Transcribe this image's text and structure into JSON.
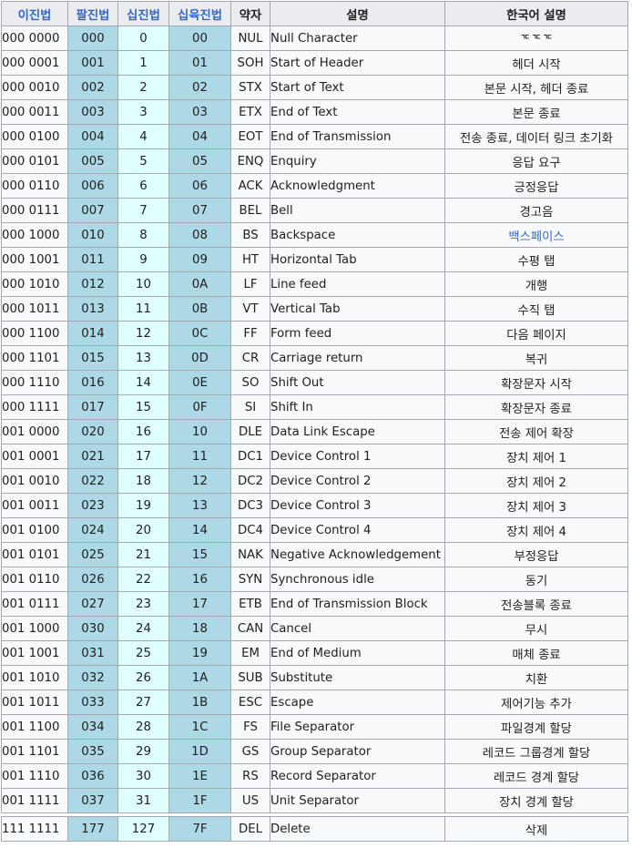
{
  "headers": {
    "binary": "이진법",
    "octal": "팔진법",
    "decimal": "십진법",
    "hex": "십육진법",
    "abbr": "약자",
    "name": "설명",
    "korean": "한국어 설명"
  },
  "rows": [
    {
      "bin": "000 0000",
      "oct": "000",
      "dec": "0",
      "hex": "00",
      "abbr": "NUL",
      "name": "Null Character",
      "kor": "ᄀᄃᄀᄃᄀᄃ"
    },
    {
      "bin": "000 0001",
      "oct": "001",
      "dec": "1",
      "hex": "01",
      "abbr": "SOH",
      "name": "Start of Header",
      "kor": "헤더 시작"
    },
    {
      "bin": "000 0010",
      "oct": "002",
      "dec": "2",
      "hex": "02",
      "abbr": "STX",
      "name": "Start of Text",
      "kor": "본문 시작, 헤더 종료"
    },
    {
      "bin": "000 0011",
      "oct": "003",
      "dec": "3",
      "hex": "03",
      "abbr": "ETX",
      "name": "End of Text",
      "kor": "본문 종료"
    },
    {
      "bin": "000 0100",
      "oct": "004",
      "dec": "4",
      "hex": "04",
      "abbr": "EOT",
      "name": "End of Transmission",
      "kor": "전송 종료, 데이터 링크 초기화"
    },
    {
      "bin": "000 0101",
      "oct": "005",
      "dec": "5",
      "hex": "05",
      "abbr": "ENQ",
      "name": "Enquiry",
      "kor": "응답 요구"
    },
    {
      "bin": "000 0110",
      "oct": "006",
      "dec": "6",
      "hex": "06",
      "abbr": "ACK",
      "name": "Acknowledgment",
      "kor": "긍정응답"
    },
    {
      "bin": "000 0111",
      "oct": "007",
      "dec": "7",
      "hex": "07",
      "abbr": "BEL",
      "name": "Bell",
      "kor": "경고음"
    },
    {
      "bin": "000 1000",
      "oct": "010",
      "dec": "8",
      "hex": "08",
      "abbr": "BS",
      "name": "Backspace",
      "kor": "백스페이스",
      "link": true
    },
    {
      "bin": "000 1001",
      "oct": "011",
      "dec": "9",
      "hex": "09",
      "abbr": "HT",
      "name": "Horizontal Tab",
      "kor": "수평 탭"
    },
    {
      "bin": "000 1010",
      "oct": "012",
      "dec": "10",
      "hex": "0A",
      "abbr": "LF",
      "name": "Line feed",
      "kor": "개행"
    },
    {
      "bin": "000 1011",
      "oct": "013",
      "dec": "11",
      "hex": "0B",
      "abbr": "VT",
      "name": "Vertical Tab",
      "kor": "수직 탭"
    },
    {
      "bin": "000 1100",
      "oct": "014",
      "dec": "12",
      "hex": "0C",
      "abbr": "FF",
      "name": "Form feed",
      "kor": "다음 페이지"
    },
    {
      "bin": "000 1101",
      "oct": "015",
      "dec": "13",
      "hex": "0D",
      "abbr": "CR",
      "name": "Carriage return",
      "kor": "복귀"
    },
    {
      "bin": "000 1110",
      "oct": "016",
      "dec": "14",
      "hex": "0E",
      "abbr": "SO",
      "name": "Shift Out",
      "kor": "확장문자 시작"
    },
    {
      "bin": "000 1111",
      "oct": "017",
      "dec": "15",
      "hex": "0F",
      "abbr": "SI",
      "name": "Shift In",
      "kor": "확장문자 종료"
    },
    {
      "bin": "001 0000",
      "oct": "020",
      "dec": "16",
      "hex": "10",
      "abbr": "DLE",
      "name": "Data Link Escape",
      "kor": "전송 제어 확장"
    },
    {
      "bin": "001 0001",
      "oct": "021",
      "dec": "17",
      "hex": "11",
      "abbr": "DC1",
      "name": "Device Control 1",
      "kor": "장치 제어 1"
    },
    {
      "bin": "001 0010",
      "oct": "022",
      "dec": "18",
      "hex": "12",
      "abbr": "DC2",
      "name": "Device Control 2",
      "kor": "장치 제어 2"
    },
    {
      "bin": "001 0011",
      "oct": "023",
      "dec": "19",
      "hex": "13",
      "abbr": "DC3",
      "name": "Device Control 3",
      "kor": "장치 제어 3"
    },
    {
      "bin": "001 0100",
      "oct": "024",
      "dec": "20",
      "hex": "14",
      "abbr": "DC4",
      "name": "Device Control 4",
      "kor": "장치 제어 4"
    },
    {
      "bin": "001 0101",
      "oct": "025",
      "dec": "21",
      "hex": "15",
      "abbr": "NAK",
      "name": "Negative Acknowledgement",
      "kor": "부정응답"
    },
    {
      "bin": "001 0110",
      "oct": "026",
      "dec": "22",
      "hex": "16",
      "abbr": "SYN",
      "name": "Synchronous idle",
      "kor": "동기"
    },
    {
      "bin": "001 0111",
      "oct": "027",
      "dec": "23",
      "hex": "17",
      "abbr": "ETB",
      "name": "End of Transmission Block",
      "kor": "전송블록 종료"
    },
    {
      "bin": "001 1000",
      "oct": "030",
      "dec": "24",
      "hex": "18",
      "abbr": "CAN",
      "name": "Cancel",
      "kor": "무시"
    },
    {
      "bin": "001 1001",
      "oct": "031",
      "dec": "25",
      "hex": "19",
      "abbr": "EM",
      "name": "End of Medium",
      "kor": "매체 종료"
    },
    {
      "bin": "001 1010",
      "oct": "032",
      "dec": "26",
      "hex": "1A",
      "abbr": "SUB",
      "name": "Substitute",
      "kor": "치환"
    },
    {
      "bin": "001 1011",
      "oct": "033",
      "dec": "27",
      "hex": "1B",
      "abbr": "ESC",
      "name": "Escape",
      "kor": "제어기능 추가"
    },
    {
      "bin": "001 1100",
      "oct": "034",
      "dec": "28",
      "hex": "1C",
      "abbr": "FS",
      "name": "File Separator",
      "kor": "파일경계 할당"
    },
    {
      "bin": "001 1101",
      "oct": "035",
      "dec": "29",
      "hex": "1D",
      "abbr": "GS",
      "name": "Group Separator",
      "kor": "레코드 그룹경계 할당"
    },
    {
      "bin": "001 1110",
      "oct": "036",
      "dec": "30",
      "hex": "1E",
      "abbr": "RS",
      "name": "Record Separator",
      "kor": "레코드 경계 할당"
    },
    {
      "bin": "001 1111",
      "oct": "037",
      "dec": "31",
      "hex": "1F",
      "abbr": "US",
      "name": "Unit Separator",
      "kor": "장치 경계 할당"
    }
  ],
  "del_row": {
    "bin": "111 1111",
    "oct": "177",
    "dec": "127",
    "hex": "7F",
    "abbr": "DEL",
    "name": "Delete",
    "kor": "삭제"
  },
  "colors": {
    "octal_bg": "#add8e6",
    "decimal_bg": "#e0ffff",
    "header_bg": "#eaecf0",
    "link": "#3366cc"
  }
}
